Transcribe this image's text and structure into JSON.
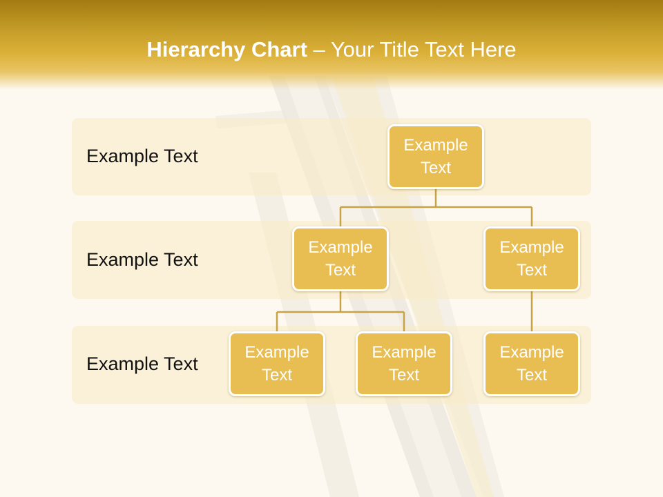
{
  "title": {
    "bold": "Hierarchy Chart",
    "separator": " – ",
    "rest": "Your Title Text Here"
  },
  "levels": [
    {
      "label": "Example Text"
    },
    {
      "label": "Example Text"
    },
    {
      "label": "Example Text"
    }
  ],
  "nodes": {
    "root": "Example Text",
    "level2_left": "Example Text",
    "level2_right": "Example Text",
    "level3_left_a": "Example Text",
    "level3_left_b": "Example Text",
    "level3_right": "Example Text"
  },
  "colors": {
    "header": "#c19a25",
    "node_fill": "#e8bd52",
    "connector": "#c7a343",
    "band": "#f8ebc8",
    "background": "#fdf9f1"
  }
}
